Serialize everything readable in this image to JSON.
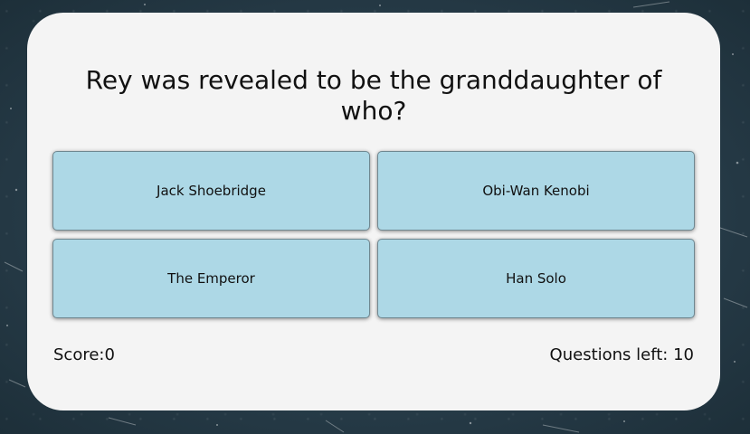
{
  "quiz": {
    "question": "Rey was revealed to be the granddaughter of who?",
    "answers": [
      "Jack Shoebridge",
      "Obi-Wan Kenobi",
      "The Emperor",
      "Han Solo"
    ],
    "score_label": "Score:",
    "score_value": "0",
    "questions_left_label": "Questions left: ",
    "questions_left_value": "10"
  },
  "colors": {
    "background": "#2c4350",
    "card": "#f4f4f4",
    "answer_button": "#add8e6",
    "text": "#111111"
  }
}
